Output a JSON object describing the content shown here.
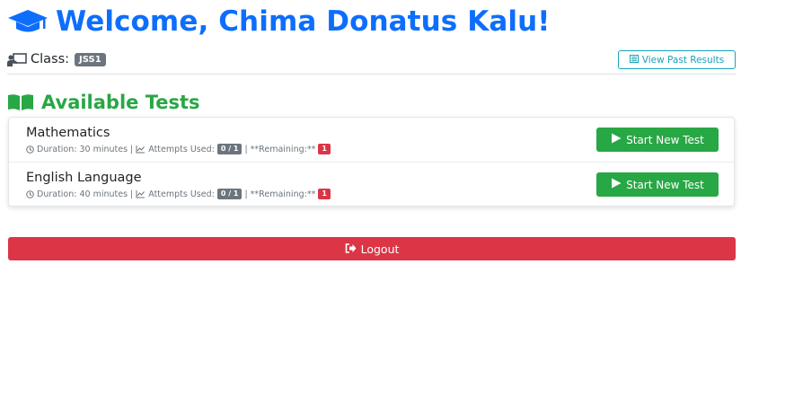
{
  "header": {
    "welcome_text": "Welcome, Chima Donatus Kalu!",
    "icon": "graduation-cap-icon"
  },
  "class_info": {
    "label": "Class:",
    "value": "JSS1",
    "icon": "chalkboard-teacher-icon"
  },
  "past_results_button": {
    "label": "View Past Results",
    "icon": "list-icon"
  },
  "available_tests": {
    "title": "Available Tests",
    "icon": "book-open-icon",
    "tests": [
      {
        "name": "Mathematics",
        "duration": "Duration: 30 minutes",
        "attempts_label": "Attempts Used:",
        "attempts_value": "0 / 1",
        "remaining_label": "**Remaining:**",
        "remaining_value": "1",
        "button_label": "Start New Test"
      },
      {
        "name": "English Language",
        "duration": "Duration: 40 minutes",
        "attempts_label": "Attempts Used:",
        "attempts_value": "0 / 1",
        "remaining_label": "**Remaining:**",
        "remaining_value": "1",
        "button_label": "Start New Test"
      }
    ]
  },
  "logout_button": {
    "label": "Logout",
    "icon": "sign-out-icon"
  },
  "colors": {
    "primary": "#0d6efd",
    "success": "#28a745",
    "danger": "#dc3545",
    "info": "#17a2b8",
    "secondary": "#6c757d"
  }
}
